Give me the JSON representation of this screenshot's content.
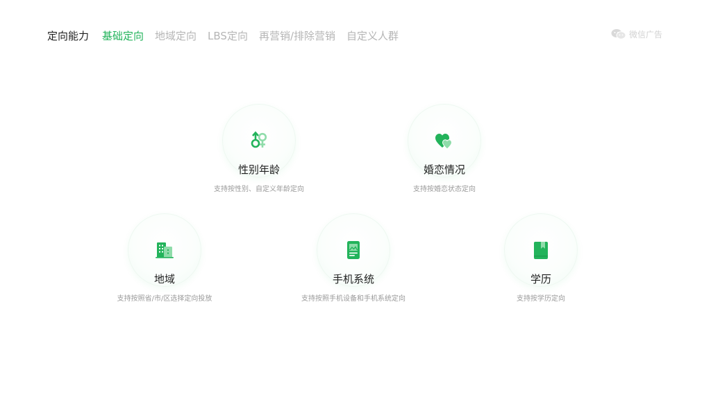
{
  "header": {
    "title": "定向能力",
    "tabs": [
      {
        "label": "基础定向",
        "active": true
      },
      {
        "label": "地域定向",
        "active": false
      },
      {
        "label": "LBS定向",
        "active": false
      },
      {
        "label": "再营销/排除营销",
        "active": false
      },
      {
        "label": "自定义人群",
        "active": false
      }
    ]
  },
  "logo": {
    "text": "微信广告",
    "icon": "wechat-icon"
  },
  "colors": {
    "accent": "#23b35b",
    "accent_light": "#8fdcaa",
    "muted_text": "#b5b5b5"
  },
  "features": [
    {
      "title": "性别年龄",
      "desc": "支持按性别、自定义年龄定向",
      "icon": "gender-icon"
    },
    {
      "title": "婚恋情况",
      "desc": "支持按婚恋状态定向",
      "icon": "hearts-icon"
    },
    {
      "title": "地域",
      "desc": "支持按照省/市/区选择定向投放",
      "icon": "buildings-icon"
    },
    {
      "title": "手机系统",
      "desc": "支持按照手机设备和手机系统定向",
      "icon": "phone-icon"
    },
    {
      "title": "学历",
      "desc": "支持按学历定向",
      "icon": "book-icon"
    }
  ]
}
